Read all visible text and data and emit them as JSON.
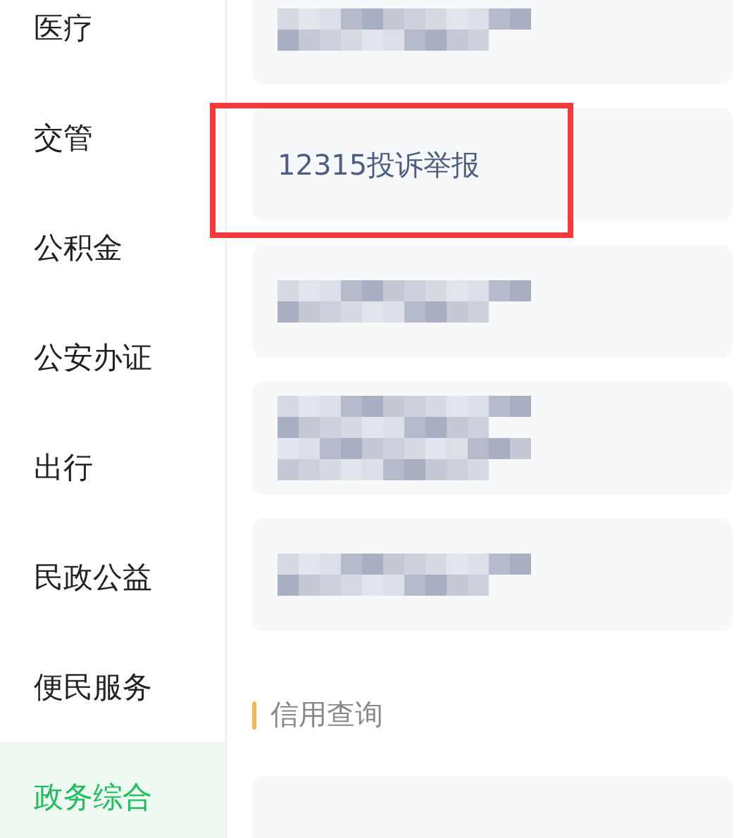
{
  "sidebar": {
    "items": [
      {
        "label": "医疗",
        "selected": false
      },
      {
        "label": "交管",
        "selected": false
      },
      {
        "label": "公积金",
        "selected": false
      },
      {
        "label": "公安办证",
        "selected": false
      },
      {
        "label": "出行",
        "selected": false
      },
      {
        "label": "民政公益",
        "selected": false
      },
      {
        "label": "便民服务",
        "selected": false
      },
      {
        "label": "政务综合",
        "selected": true
      }
    ]
  },
  "cards": [
    {
      "kind": "blurred"
    },
    {
      "kind": "text",
      "label": "12315投诉举报",
      "highlighted": true
    },
    {
      "kind": "blurred"
    },
    {
      "kind": "blurredtall"
    },
    {
      "kind": "blurred"
    }
  ],
  "section": {
    "title": "信用查询",
    "cards": [
      {
        "kind": "blank"
      }
    ]
  }
}
